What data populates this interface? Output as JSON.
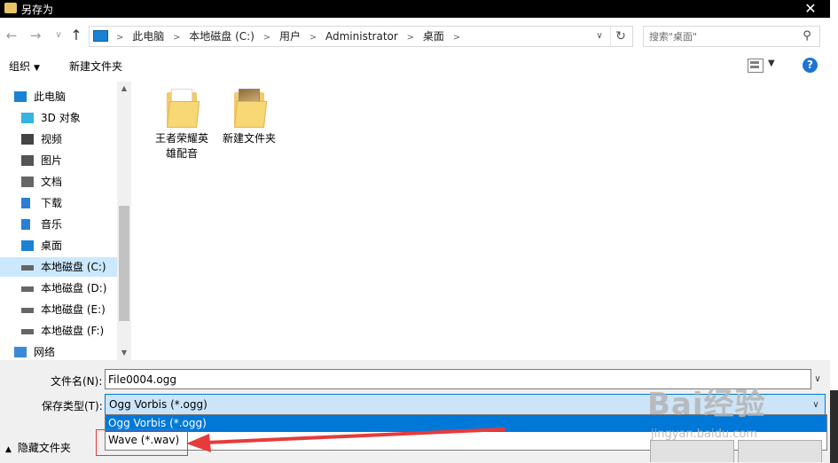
{
  "window": {
    "title": "另存为",
    "close_glyph": "✕"
  },
  "nav": {
    "back_glyph": "←",
    "forward_glyph": "→",
    "recent_glyph": "∨",
    "up_glyph": "↑",
    "breadcrumbs": [
      "此电脑",
      "本地磁盘 (C:)",
      "用户",
      "Administrator",
      "桌面"
    ],
    "refresh_glyph": "↻",
    "dropdown_glyph": "∨"
  },
  "search": {
    "placeholder": "搜索\"桌面\""
  },
  "toolbar": {
    "organize": "组织",
    "new_folder": "新建文件夹",
    "help": "?"
  },
  "sidebar": {
    "items": [
      {
        "label": "此电脑",
        "icon": "computer-icon",
        "indent": 0
      },
      {
        "label": "3D 对象",
        "icon": "cube-icon",
        "indent": 1
      },
      {
        "label": "视频",
        "icon": "video-icon",
        "indent": 1
      },
      {
        "label": "图片",
        "icon": "picture-icon",
        "indent": 1
      },
      {
        "label": "文档",
        "icon": "document-icon",
        "indent": 1
      },
      {
        "label": "下载",
        "icon": "download-icon",
        "indent": 1
      },
      {
        "label": "音乐",
        "icon": "music-icon",
        "indent": 1
      },
      {
        "label": "桌面",
        "icon": "desktop-icon",
        "indent": 1
      },
      {
        "label": "本地磁盘 (C:)",
        "icon": "system-drive-icon",
        "indent": 1,
        "selected": true
      },
      {
        "label": "本地磁盘 (D:)",
        "icon": "drive-icon",
        "indent": 1
      },
      {
        "label": "本地磁盘 (E:)",
        "icon": "drive-icon",
        "indent": 1
      },
      {
        "label": "本地磁盘 (F:)",
        "icon": "drive-icon",
        "indent": 1
      },
      {
        "label": "网络",
        "icon": "network-icon",
        "indent": 0
      }
    ]
  },
  "files": [
    {
      "name": "王者荣耀英雄配音",
      "icon": "folder-icon"
    },
    {
      "name": "新建文件夹",
      "icon": "folder-icon"
    }
  ],
  "bottom": {
    "filename_label": "文件名(N):",
    "filename_value": "File0004.ogg",
    "filetype_label": "保存类型(T):",
    "filetype_value": "Ogg Vorbis (*.ogg)",
    "filetype_options": [
      "Ogg Vorbis (*.ogg)",
      "Wave (*.wav)"
    ],
    "hide_folders": "隐藏文件夹"
  },
  "watermark": {
    "brand": "Bai经验",
    "url": "jingyan.baidu.com"
  },
  "colors": {
    "accent": "#0078d7",
    "selection": "#cce8ff",
    "annotation_red": "#e63b3b"
  }
}
